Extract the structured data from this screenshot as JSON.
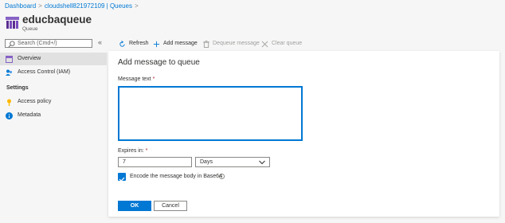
{
  "breadcrumb": {
    "items": [
      "Dashboard",
      "cloudshell821972109 | Queues"
    ],
    "separator": ">"
  },
  "header": {
    "title": "educbaqueue",
    "subtitle": "Queue",
    "icon": "queue-icon"
  },
  "sidebar": {
    "search_placeholder": "Search (Cmd+/)",
    "collapse_glyph": "«",
    "items": [
      {
        "label": "Overview",
        "icon": "overview-icon",
        "active": true
      },
      {
        "label": "Access Control (IAM)",
        "icon": "iam-icon",
        "active": false
      }
    ],
    "settings_header": "Settings",
    "settings_items": [
      {
        "label": "Access policy",
        "icon": "key-icon"
      },
      {
        "label": "Metadata",
        "icon": "info-icon"
      }
    ]
  },
  "toolbar": {
    "refresh": "Refresh",
    "add_message": "Add message",
    "dequeue_message": "Dequeue message",
    "clear_queue": "Clear queue"
  },
  "panel": {
    "title": "Add message to queue",
    "message_label": "Message text",
    "message_value": "",
    "expires_label": "Expires in:",
    "required_mark": "*",
    "expires_value": "7",
    "expires_unit": "Days",
    "encode_label": "Encode the message body in Base64",
    "encode_checked": true,
    "ok": "OK",
    "cancel": "Cancel"
  },
  "colors": {
    "accent": "#0078d4",
    "required": "#a4262c"
  }
}
